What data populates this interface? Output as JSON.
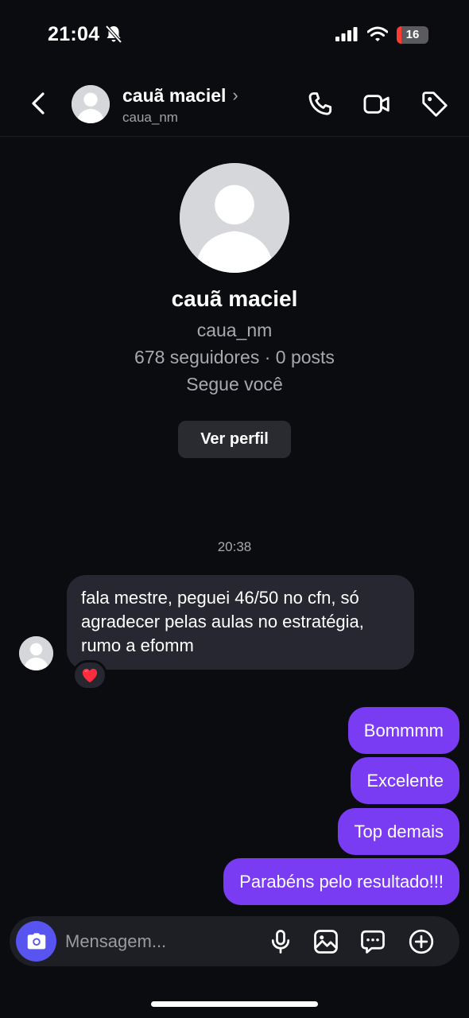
{
  "status_bar": {
    "time": "21:04",
    "battery_level": "16",
    "battery_fraction": 0.16,
    "icons": [
      "bell-muted-icon",
      "signal-icon",
      "wifi-icon",
      "battery-icon"
    ]
  },
  "header": {
    "name": "cauã maciel",
    "chevron": "›",
    "username": "caua_nm",
    "icons": [
      "back-arrow-icon",
      "phone-icon",
      "video-camera-icon",
      "tag-icon"
    ]
  },
  "profile": {
    "name": "cauã maciel",
    "username": "caua_nm",
    "stats": "678 seguidores · 0 posts",
    "follow_status": "Segue você",
    "view_profile_label": "Ver perfil"
  },
  "conversation": {
    "timestamp": "20:38",
    "incoming_message": "fala mestre, peguei 46/50 no cfn, só agradecer pelas aulas no estratégia, rumo a efomm",
    "reaction": "❤️",
    "outgoing_messages": [
      "Bommmm",
      "Excelente",
      "Top demais",
      "Parabéns pelo resultado!!!"
    ]
  },
  "composer": {
    "placeholder": "Mensagem...",
    "icons": [
      "camera-icon",
      "microphone-icon",
      "gallery-icon",
      "sticker-icon",
      "plus-icon"
    ]
  },
  "colors": {
    "background": "#0b0c10",
    "incoming_bubble": "#262730",
    "outgoing_bubble": "#7a3cf2",
    "camera_button": "#5754f0",
    "secondary_text": "#a8a9ae"
  }
}
